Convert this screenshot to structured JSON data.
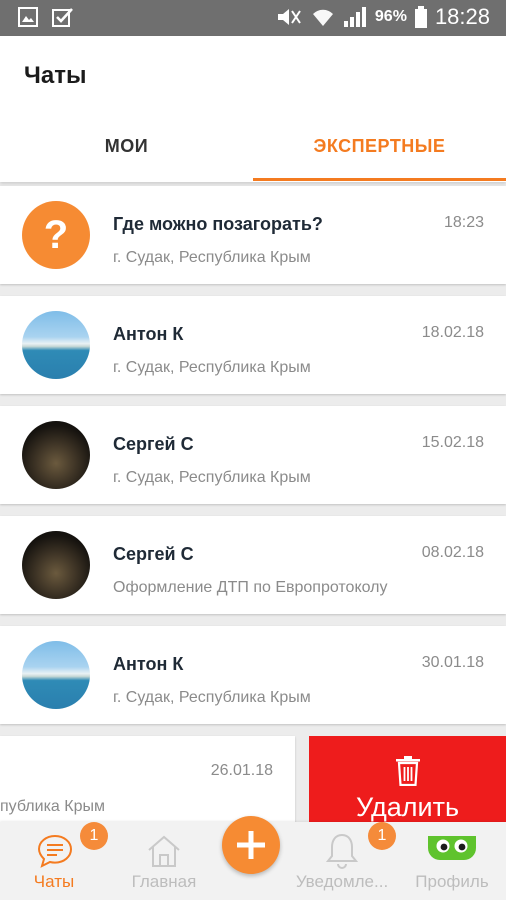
{
  "status_bar": {
    "battery": "96%",
    "time": "18:28"
  },
  "header": {
    "title": "Чаты",
    "tabs": [
      {
        "label": "МОИ",
        "active": false
      },
      {
        "label": "ЭКСПЕРТНЫЕ",
        "active": true
      }
    ]
  },
  "chats": [
    {
      "name": "Где можно позагорать?",
      "subtitle": "г. Судак, Республика Крым",
      "date": "18:23",
      "avatar": "question-avatar"
    },
    {
      "name": "Антон К",
      "subtitle": "г. Судак, Республика Крым",
      "date": "18.02.18",
      "avatar": "sea-photo"
    },
    {
      "name": "Сергей С",
      "subtitle": "г. Судак, Республика Крым",
      "date": "15.02.18",
      "avatar": "dark-photo"
    },
    {
      "name": "Сергей С",
      "subtitle": "Оформление ДТП по Европротоколу",
      "date": "08.02.18",
      "avatar": "dark-photo"
    },
    {
      "name": "Антон К",
      "subtitle": "г. Судак, Республика Крым",
      "date": "30.01.18",
      "avatar": "sea-photo"
    }
  ],
  "swiped_chat": {
    "date": "26.01.18",
    "subtitle_visible": "публика Крым",
    "delete_label": "Удалить"
  },
  "bottom_nav": {
    "items": [
      {
        "label": "Чаты",
        "badge": "1",
        "active": true
      },
      {
        "label": "Главная"
      },
      {
        "label": "Уведомле...",
        "badge": "1"
      },
      {
        "label": "Профиль"
      }
    ]
  },
  "colors": {
    "accent": "#f47b20",
    "delete": "#ee1c1c",
    "profile_icon": "#5fc32d"
  }
}
